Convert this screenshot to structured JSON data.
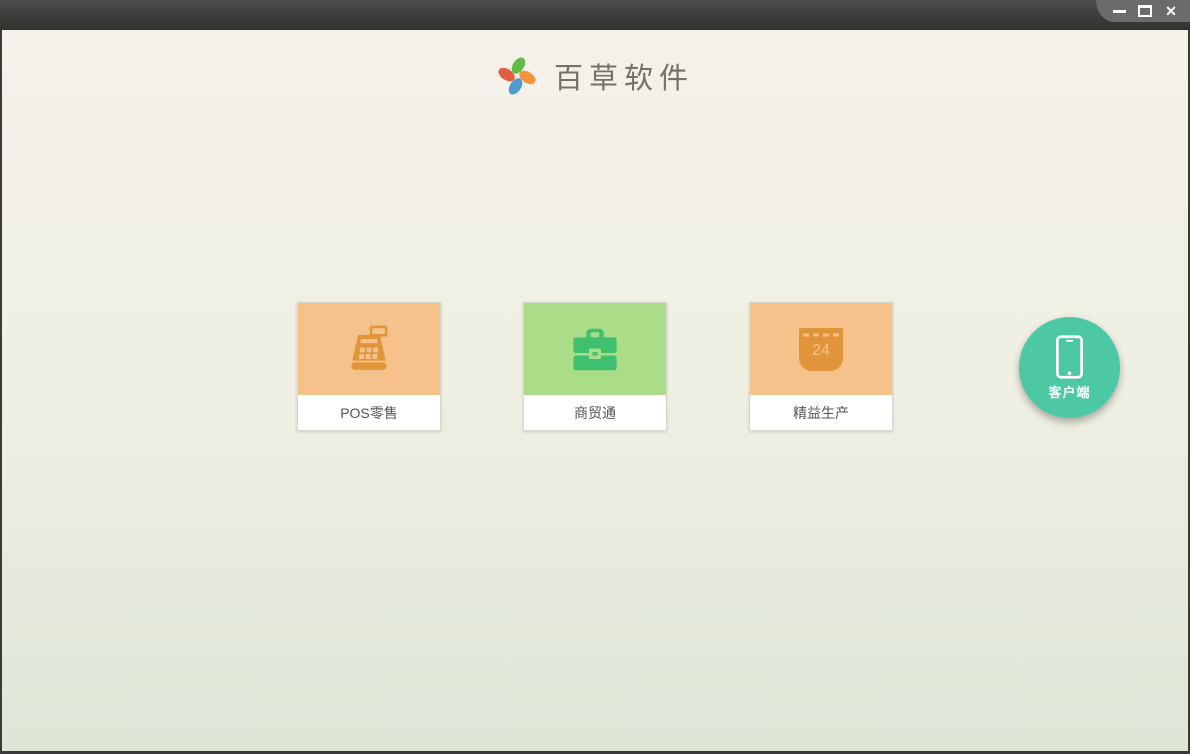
{
  "window": {
    "controls": {
      "minimize": "minimize",
      "maximize": "maximize",
      "close_icon": "✕"
    }
  },
  "header": {
    "app_title": "百草软件",
    "logo_petal_colors": {
      "top": "#62bb47",
      "right": "#f1953f",
      "bottom": "#4f98d0",
      "left": "#e25c41"
    }
  },
  "products": [
    {
      "label": "POS零售",
      "icon": "cash-register-icon",
      "tile_bg": "#f6c28b",
      "icon_color": "#e0953a"
    },
    {
      "label": "商贸通",
      "icon": "briefcase-icon",
      "tile_bg": "#abdc87",
      "icon_color": "#3fc06f"
    },
    {
      "label": "精益生产",
      "icon": "calendar-icon",
      "tile_bg": "#f6c28b",
      "icon_color": "#e0953a",
      "calendar_day": "24"
    }
  ],
  "client": {
    "label": "客户端",
    "icon": "smartphone-icon",
    "bg": "#4cc8a2"
  },
  "colors": {
    "titlebar_top": "#4d4d4b",
    "titlebar_bottom": "#323230",
    "frame_border": "#3a3a38",
    "bg_top": "#f4f1ea",
    "bg_bottom": "#dee6d6",
    "card_border": "#d9d6cb",
    "label_text": "#555555",
    "title_text": "#73716a"
  }
}
